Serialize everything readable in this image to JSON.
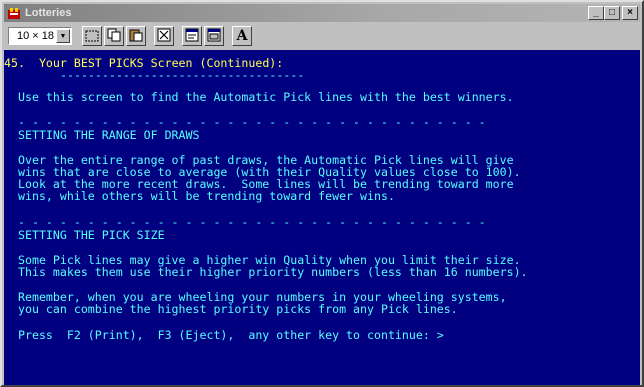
{
  "window": {
    "title": "Lotteries",
    "minimize_label": "_",
    "maximize_label": "□",
    "close_label": "×"
  },
  "toolbar": {
    "font_size_value": "10 × 18",
    "font_button_label": "A"
  },
  "console": {
    "section_number": "45.",
    "section_title": "Your BEST PICKS Screen (Continued):",
    "title_underline": "-----------------------------------",
    "intro": "Use this screen to find the Automatic Pick lines with the best winners.",
    "divider": "- - - - - - - - - - - - - - - - - - - - - - - - - - - - - - - - - -",
    "range_heading": "SETTING THE RANGE OF DRAWS",
    "range_lines": [
      "Over the entire range of past draws, the Automatic Pick lines will give",
      "wins that are close to average (with their Quality values close to 100).",
      "Look at the more recent draws.  Some lines will be trending toward more",
      "wins, while others will be trending toward fewer wins."
    ],
    "size_heading": "SETTING THE PICK SIZE",
    "size_lines": [
      "Some Pick lines may give a higher win Quality when you limit their size.",
      "This makes them use their higher priority numbers (less than 16 numbers)."
    ],
    "remember_lines": [
      "Remember, when you are wheeling your numbers in your wheeling systems,",
      "you can combine the highest priority picks from any Pick lines."
    ],
    "prompt": "Press  F2 (Print),  F3 (Eject),  any other key to continue: >"
  },
  "colors": {
    "console_bg": "#000080",
    "text_yellow": "#ffff55",
    "text_cyan": "#55ffff"
  },
  "icons": {
    "app": "lottery-app-icon",
    "toolbar": [
      "mark-icon",
      "copy-icon",
      "paste-icon",
      "fullscreen-icon",
      "properties-icon",
      "background-icon",
      "font-icon"
    ]
  }
}
